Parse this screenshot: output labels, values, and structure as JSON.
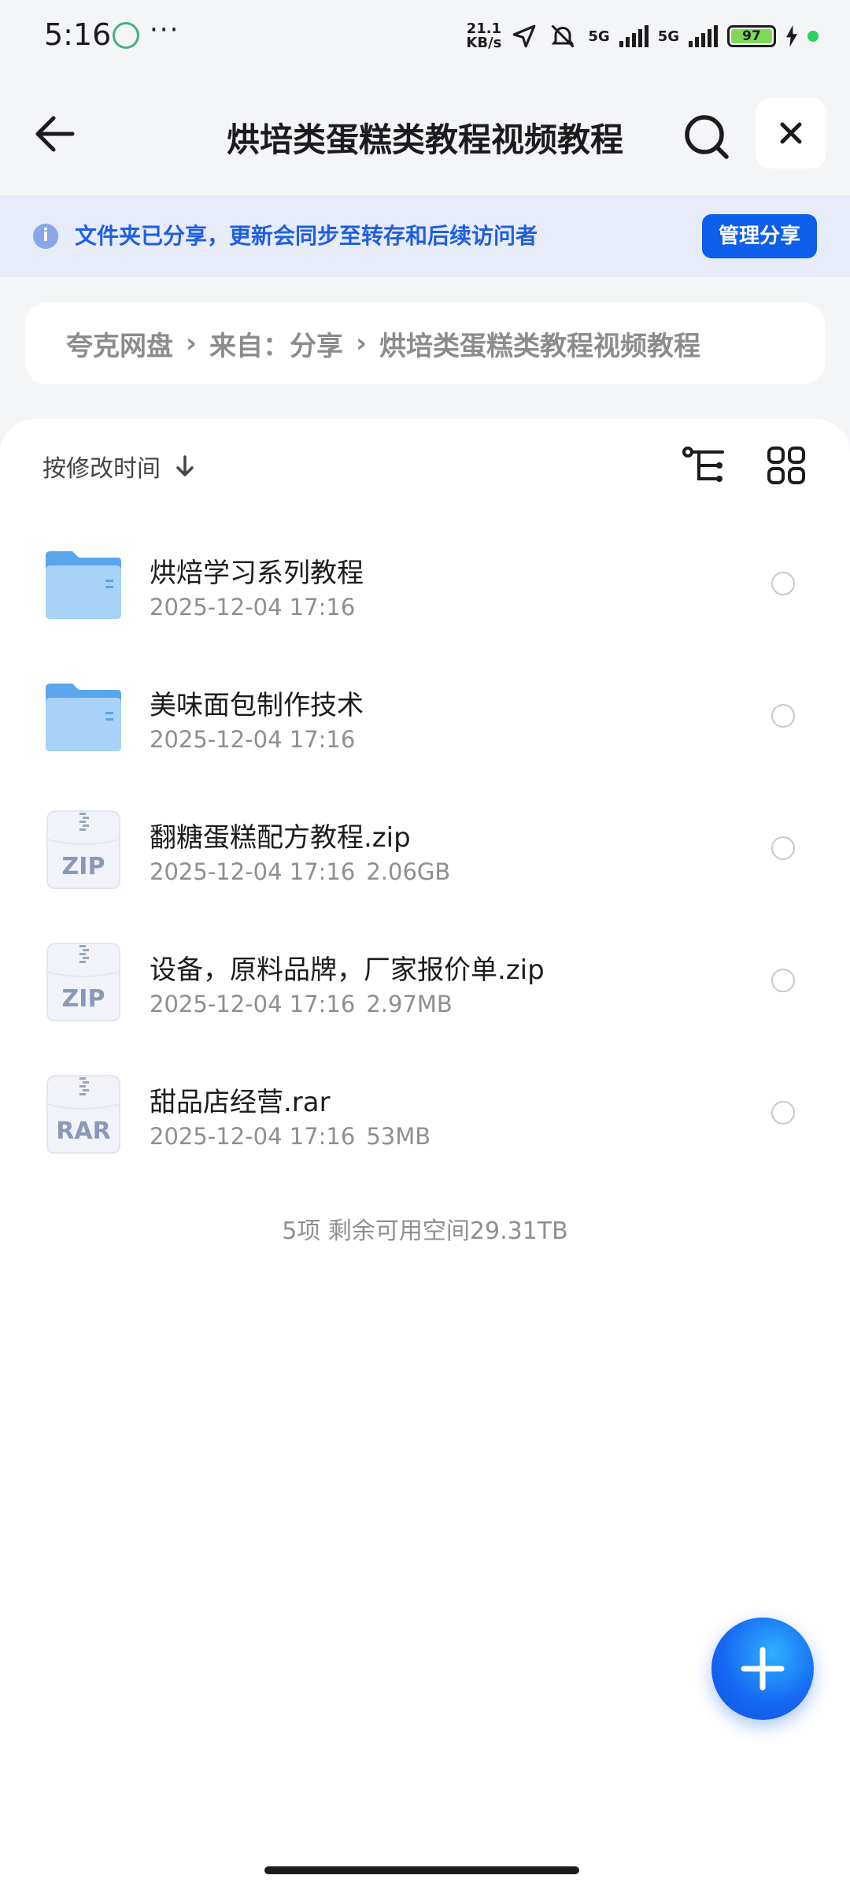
{
  "status_bar": {
    "time": "5:16",
    "more": "···",
    "speed_top": "21.1",
    "speed_unit": "KB/s",
    "net1": "5G",
    "net2": "5G",
    "battery": "97"
  },
  "header": {
    "title": "烘培类蛋糕类教程视频教程"
  },
  "banner": {
    "text": "文件夹已分享，更新会同步至转存和后续访问者",
    "manage_label": "管理分享"
  },
  "breadcrumb": [
    "夸克网盘",
    "来自：分享",
    "烘培类蛋糕类教程视频教程"
  ],
  "breadcrumb_sep": "›",
  "sort": {
    "label": "按修改时间"
  },
  "files": [
    {
      "name": "烘焙学习系列教程",
      "date": "2025-12-04 17:16",
      "size": "",
      "type": "folder"
    },
    {
      "name": "美味面包制作技术",
      "date": "2025-12-04 17:16",
      "size": "",
      "type": "folder"
    },
    {
      "name": "翻糖蛋糕配方教程.zip",
      "date": "2025-12-04 17:16",
      "size": "2.06GB",
      "type": "ZIP"
    },
    {
      "name": "设备，原料品牌，厂家报价单.zip",
      "date": "2025-12-04 17:16",
      "size": "2.97MB",
      "type": "ZIP"
    },
    {
      "name": "甜品店经营.rar",
      "date": "2025-12-04 17:16",
      "size": "53MB",
      "type": "RAR"
    }
  ],
  "summary": "5项 剩余可用空间29.31TB",
  "colors": {
    "accent": "#0d5eea",
    "banner_bg": "#e8ecf9",
    "folder": "#5aa6ec"
  }
}
